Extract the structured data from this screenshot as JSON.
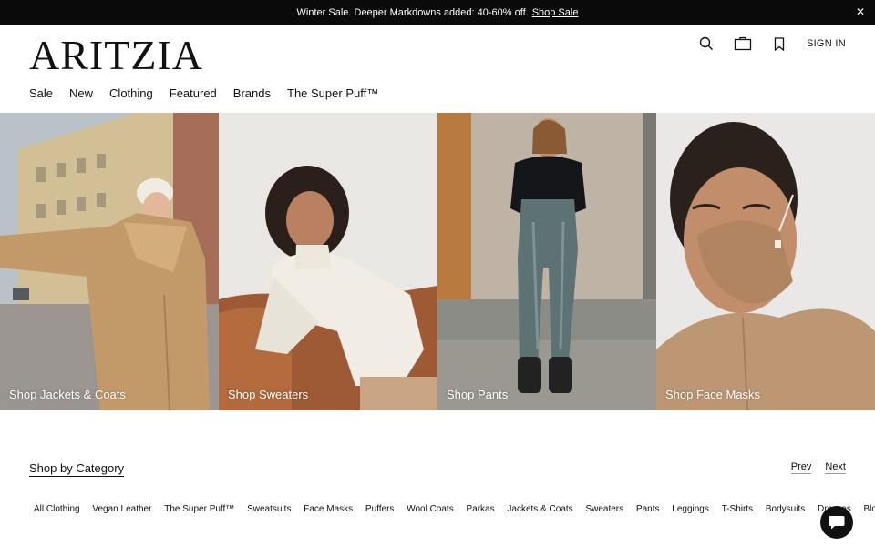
{
  "promo": {
    "text": "Winter Sale. Deeper Markdowns added: 40-60% off.",
    "link": "Shop Sale",
    "close_icon": "close-icon"
  },
  "header": {
    "logo": "ARITZIA",
    "icons": [
      "search-icon",
      "bag-icon",
      "bookmark-icon"
    ],
    "sign_in": "SIGN IN"
  },
  "nav": {
    "items": [
      "Sale",
      "New",
      "Clothing",
      "Featured",
      "Brands",
      "The Super Puff™"
    ]
  },
  "tiles": [
    {
      "caption": "Shop Jackets & Coats"
    },
    {
      "caption": "Shop Sweaters"
    },
    {
      "caption": "Shop Pants"
    },
    {
      "caption": "Shop Face Masks"
    }
  ],
  "category": {
    "title": "Shop by Category",
    "prev": "Prev",
    "next": "Next",
    "items": [
      "All Clothing",
      "Vegan Leather",
      "The Super Puff™",
      "Sweatsuits",
      "Face Masks",
      "Puffers",
      "Wool Coats",
      "Parkas",
      "Jackets & Coats",
      "Sweaters",
      "Pants",
      "Leggings",
      "T-Shirts",
      "Bodysuits",
      "Dresses",
      "Blouses"
    ]
  },
  "chat": {
    "icon": "chat-icon"
  }
}
